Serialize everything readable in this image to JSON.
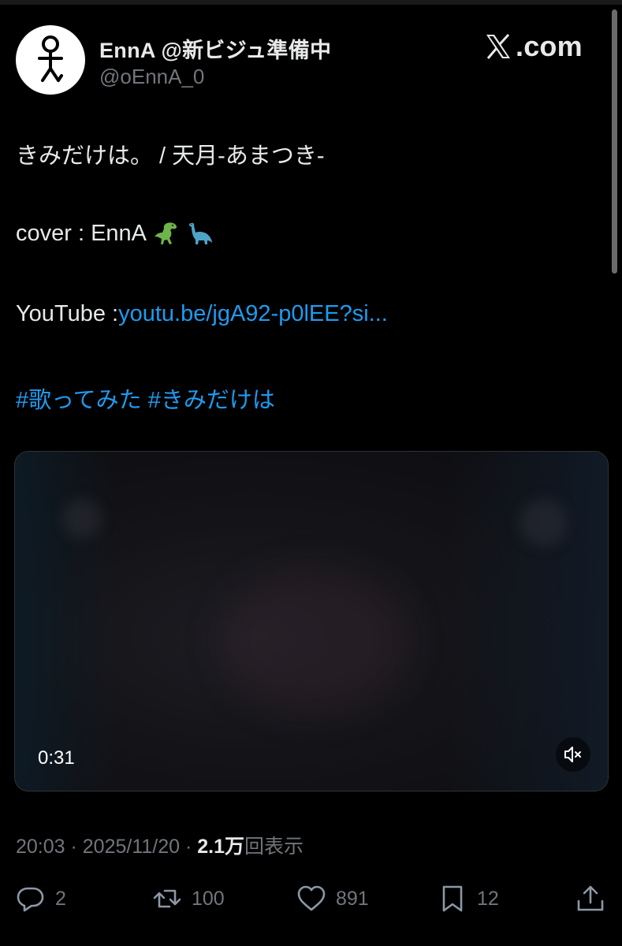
{
  "author": {
    "display_name": "EnnA @新ビジュ準備中",
    "handle": "@oEnnA_0",
    "avatar_icon": "stick-figure-icon"
  },
  "brand": {
    "logo_icon": "x-logo-icon",
    "site_text": ".com"
  },
  "tweet": {
    "line1": "きみだけは。 / 天月-あまつき-",
    "line2_text": "cover : EnnA ",
    "line2_emoji": [
      "t-rex-emoji",
      "sauropod-emoji"
    ],
    "line3_prefix": "YouTube :",
    "line3_link": "youtu.be/jgA92-p0lEE?si...",
    "hashtags": "#歌ってみた #きみだけは"
  },
  "video": {
    "duration": "0:31",
    "mute_icon": "speaker-muted-icon"
  },
  "meta": {
    "time": "20:03",
    "date": "2025/11/20",
    "views": "2.1万",
    "views_label": "回表示",
    "separator": " · "
  },
  "actions": {
    "replies": "2",
    "retweets": "100",
    "likes": "891",
    "bookmarks": "12"
  },
  "colors": {
    "background": "#000000",
    "text": "#e7e9ea",
    "muted": "#71767b",
    "link": "#1d9bf0"
  }
}
